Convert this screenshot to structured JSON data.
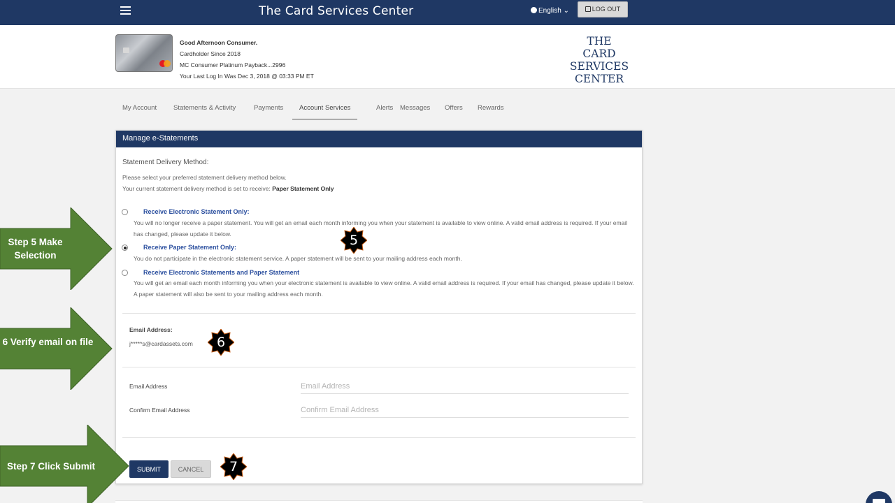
{
  "topbar": {
    "title": "The Card Services Center",
    "language": "English ⌄",
    "logout_label": "LOG OUT"
  },
  "header": {
    "greeting": "Good Afternoon Consumer.",
    "cardholder_since": "Cardholder Since 2018",
    "account": "MC Consumer Platinum Payback...2996",
    "last_login": "Your Last Log In Was Dec 3, 2018 @ 03:33 PM ET",
    "logo_lines": [
      "THE",
      "CARD SERVICES",
      "CENTER"
    ]
  },
  "tabs": [
    "My Account",
    "Statements & Activity",
    "Payments",
    "Account Services",
    "Alerts",
    "Messages",
    "Offers",
    "Rewards"
  ],
  "active_tab": "Account Services",
  "panel": {
    "title": "Manage e-Statements",
    "section_title": "Statement Delivery Method:",
    "instruction": "Please select your preferred statement delivery method below.",
    "current_prefix": "Your current statement delivery method is set to receive: ",
    "current_value": "Paper Statement Only",
    "options": [
      {
        "title": "Receive Electronic Statement Only:",
        "desc": "You will no longer receive a paper statement. You will get an email each month informing you when your statement is available to view online. A valid email address is required. If your email has changed, please update it below.",
        "checked": false
      },
      {
        "title": "Receive Paper Statement Only:",
        "desc": "You do not participate in the electronic statement service. A paper statement will be sent to your mailing address each month.",
        "checked": true
      },
      {
        "title": "Receive Electronic Statements and Paper Statement",
        "desc": "You will get an email each month informing you when your electronic statement is available to view online. A valid email address is required. If your email has changed, please update it below. A paper statement will also be sent to your mailing address each month.",
        "checked": false
      }
    ],
    "email_label": "Email Address:",
    "email_value": "j*****s@cardassets.com",
    "email_field_label": "Email Address",
    "email_placeholder": "Email Address",
    "confirm_field_label": "Confirm Email Address",
    "confirm_placeholder": "Confirm Email Address",
    "submit_label": "SUBMIT",
    "cancel_label": "CANCEL"
  },
  "annotations": {
    "step5": "Step 5 Make Selection",
    "step6": "Step 6 Verify email on file",
    "step7": "Step 7 Click Submit",
    "badge5": "5",
    "badge6": "6",
    "badge7": "7"
  },
  "colors": {
    "navy": "#1f3864",
    "arrow_green": "#548235",
    "link_blue": "#2a4e9e"
  },
  "icons": [
    "hamburger-icon",
    "globe-icon",
    "logout-icon",
    "mail-icon"
  ]
}
